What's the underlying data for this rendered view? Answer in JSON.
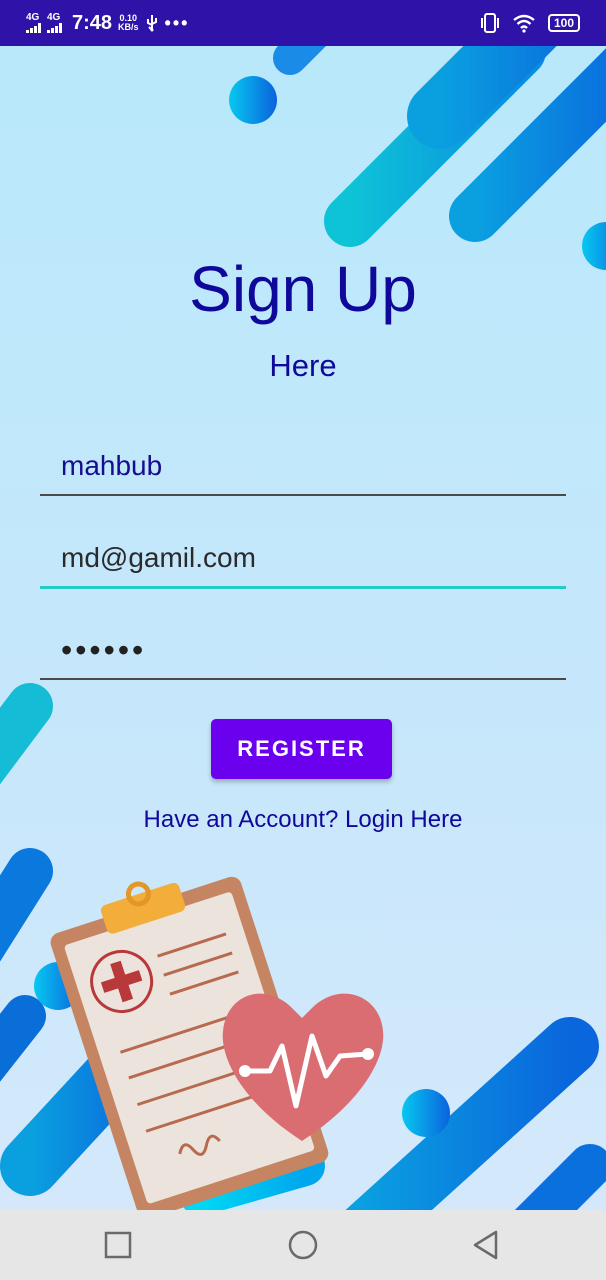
{
  "status_bar": {
    "network_1": "4G",
    "network_2": "4G",
    "time": "7:48",
    "speed_value": "0.10",
    "speed_unit": "KB/s",
    "more": "•••",
    "battery": "100"
  },
  "page": {
    "title": "Sign Up",
    "subtitle": "Here"
  },
  "form": {
    "name_value": "mahbub",
    "email_value": "md@gamil.com",
    "password_value": "••••••",
    "register_label": "REGISTER",
    "login_link": "Have an Account? Login Here"
  },
  "colors": {
    "accent": "#6a00ee",
    "title": "#10089a",
    "status_bar": "#2f13a8",
    "focus_underline": "#23cdc4"
  },
  "icons": {
    "signal": "signal-icon",
    "usb": "usb-icon",
    "vibrate": "vibrate-icon",
    "wifi": "wifi-icon",
    "battery": "battery-icon",
    "nav_recent": "square-icon",
    "nav_home": "circle-icon",
    "nav_back": "triangle-back-icon",
    "illustration": "medical-clipboard-heart-illustration"
  }
}
